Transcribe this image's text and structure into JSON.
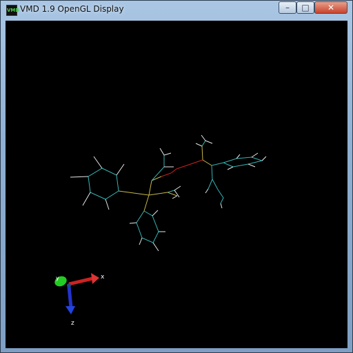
{
  "window": {
    "title": "VMD 1.9 OpenGL Display",
    "app_icon": "VMD",
    "controls": {
      "minimize": "–",
      "maximize": "□",
      "close": "✕"
    }
  },
  "axes": {
    "x_label": "x",
    "y_label": "y",
    "z_label": "z"
  },
  "colors": {
    "background": "#000000",
    "carbon": "#35b5b5",
    "hydrogen": "#e8e8e8",
    "phosphorus": "#c8b848",
    "oxygen": "#d02020",
    "axis_x": "#cc2222",
    "axis_y": "#22cc22",
    "axis_z": "#2233cc"
  }
}
